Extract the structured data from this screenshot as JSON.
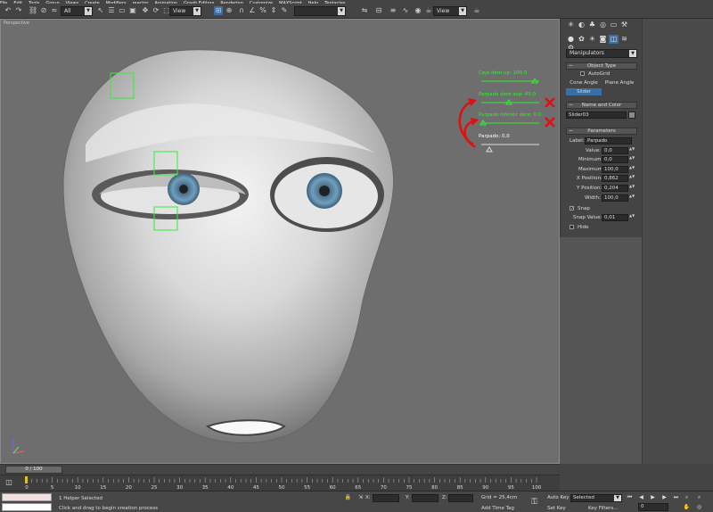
{
  "menu": [
    "File",
    "Edit",
    "Tools",
    "Group",
    "Views",
    "Create",
    "Modifiers",
    "reactor",
    "Animation",
    "Graph Editors",
    "Rendering",
    "Customize",
    "MAXScript",
    "Help",
    "Tentacles"
  ],
  "toolbar": {
    "selection_filter": "All",
    "ref_coord": "View",
    "named_selection": "",
    "view_right": "View"
  },
  "viewport": {
    "label": "Perspective",
    "sliders": [
      {
        "label": "Ceja dere up: 100,0"
      },
      {
        "label": "Parpado dere sup: 45,0"
      },
      {
        "label": "Parpado inferior dere: 0,0"
      },
      {
        "label": "Parpado: 0,0"
      }
    ]
  },
  "command_panel": {
    "dropdown": "Manipulators",
    "rollouts": {
      "object_type": "Object Type",
      "name_color": "Name and Color",
      "parameters": "Parameters"
    },
    "autogrid_label": "AutoGrid",
    "buttons": {
      "cone_angle": "Cone Angle",
      "plane_angle": "Plane Angle",
      "slider": "Slider"
    },
    "object_name": "Slider03",
    "params": {
      "label_label": "Label:",
      "label_value": "Parpado",
      "value_label": "Value:",
      "value": "0,0",
      "minimum_label": "Minimum:",
      "minimum": "0,0",
      "maximum_label": "Maximum:",
      "maximum": "100,0",
      "xpos_label": "X Position:",
      "xpos": "0,862",
      "ypos_label": "Y Position:",
      "ypos": "0,204",
      "width_label": "Width:",
      "width": "100,0",
      "snap_label": "Snap",
      "snap_value_label": "Snap Value:",
      "snap_value": "0,01",
      "hide_label": "Hide"
    }
  },
  "timeline": {
    "frame_display": "0 / 100",
    "ticks": [
      "0",
      "5",
      "10",
      "15",
      "20",
      "25",
      "30",
      "35",
      "40",
      "45",
      "50",
      "55",
      "60",
      "65",
      "70",
      "75",
      "80",
      "85",
      "90",
      "95",
      "100"
    ]
  },
  "status": {
    "selection": "1 Helper Selected",
    "prompt": "Click and drag to begin creation process",
    "x_label": "X:",
    "y_label": "Y:",
    "z_label": "Z:",
    "grid": "Grid = 25,4cm",
    "add_time_tag": "Add Time Tag",
    "auto_key": "Auto Key",
    "selected": "Selected",
    "set_key": "Set Key",
    "key_filters": "Key Filters...",
    "frame": "0"
  },
  "colors": {
    "viewport_bg": "#6e6e6e",
    "helper_green": "#33ee33",
    "annotation_red": "#e01010",
    "active_blue": "#3a6ea5"
  }
}
